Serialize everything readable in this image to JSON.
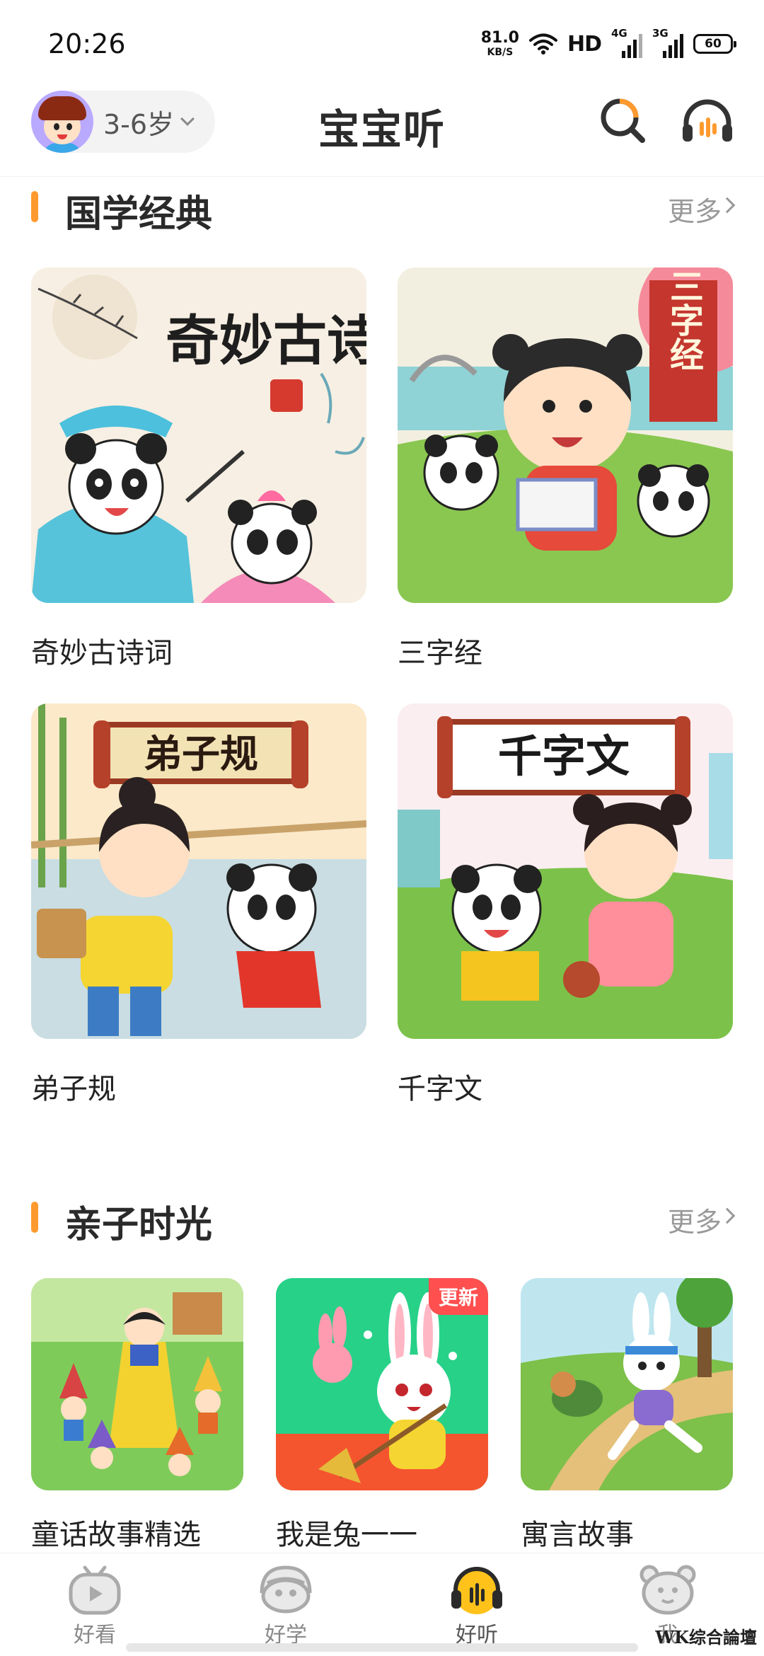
{
  "status_bar": {
    "time": "20:26",
    "net_speed_value": "81.0",
    "net_speed_unit": "KB/S",
    "hd_label": "HD",
    "signal_1": "4G",
    "signal_2": "3G",
    "battery": "60"
  },
  "header": {
    "age_label": "3-6岁",
    "title": "宝宝听"
  },
  "sections": [
    {
      "title": "国学经典",
      "more": "更多",
      "items": [
        {
          "title": "奇妙古诗词",
          "cover_text": "奇妙古诗词"
        },
        {
          "title": "三字经",
          "cover_text": "三字经"
        },
        {
          "title": "弟子规",
          "cover_text": "弟子规"
        },
        {
          "title": "千字文",
          "cover_text": "千字文"
        }
      ]
    },
    {
      "title": "亲子时光",
      "more": "更多",
      "items": [
        {
          "title": "童话故事精选"
        },
        {
          "title": "我是兔一一",
          "badge": "更新"
        },
        {
          "title": "寓言故事"
        }
      ]
    }
  ],
  "bottom_nav": [
    {
      "label": "好看",
      "icon": "play-icon"
    },
    {
      "label": "好学",
      "icon": "learn-icon"
    },
    {
      "label": "好听",
      "icon": "headphone-icon",
      "active": true
    },
    {
      "label": "我",
      "icon": "bear-icon"
    }
  ],
  "watermark": "WK综合論壇",
  "colors": {
    "accent": "#ff9a2e",
    "badge": "#ff4f4f",
    "active_nav": "#ffb300"
  }
}
